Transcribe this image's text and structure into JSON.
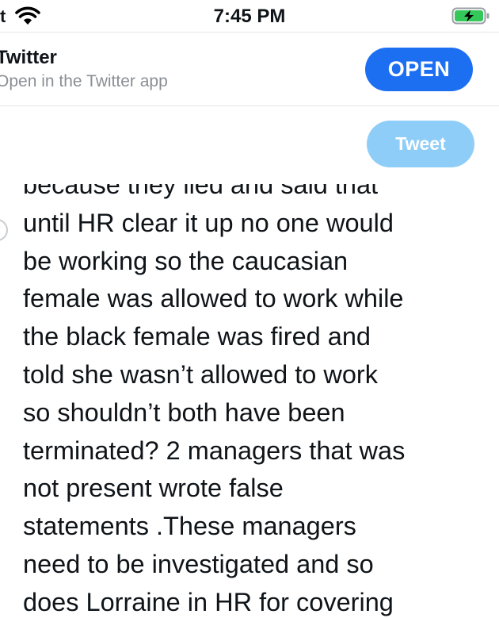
{
  "status_bar": {
    "carrier": "t",
    "time": "7:45 PM"
  },
  "banner": {
    "app_name": "Twitter",
    "subtitle": "Open in the Twitter app",
    "open_label": "OPEN"
  },
  "composer": {
    "tweet_label": "Tweet",
    "text": "because they lied and said that\nuntil HR clear it up no one would\nbe working so the caucasian\nfemale was allowed to work while\nthe black female was fired and\ntold she wasn’t allowed to work\nso shouldn’t both have been\nterminated? 2 managers that was\nnot present wrote false\nstatements .These managers\nneed to be investigated and so\ndoes Lorraine in HR for covering"
  },
  "colors": {
    "accent": "#1d6ff2",
    "tweet_disabled": "#8ecdf8",
    "battery": "#34c759"
  }
}
